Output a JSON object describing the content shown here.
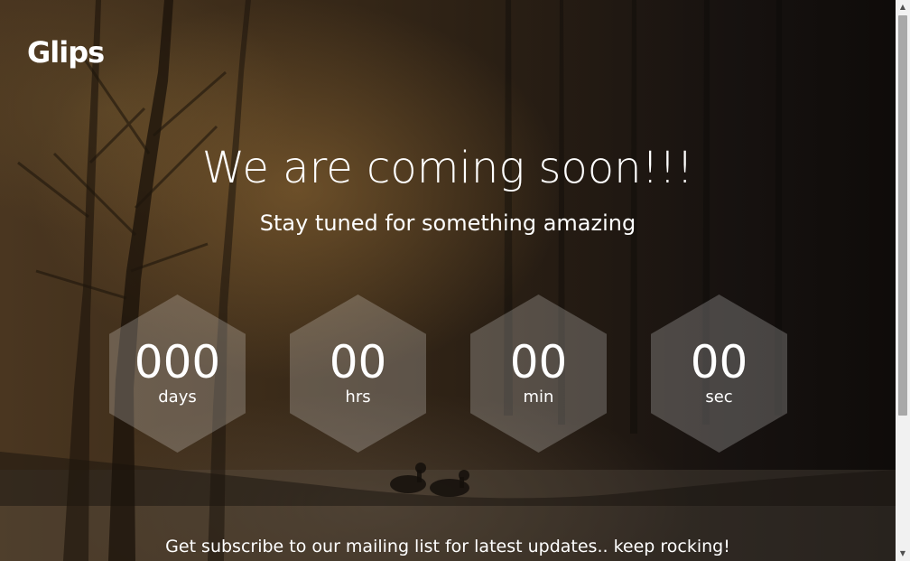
{
  "brand": {
    "logo_text": "Glips"
  },
  "hero": {
    "title": "We are coming soon!!!",
    "subtitle": "Stay tuned for something amazing"
  },
  "countdown": [
    {
      "value": "000",
      "unit": "days"
    },
    {
      "value": "00",
      "unit": "hrs"
    },
    {
      "value": "00",
      "unit": "min"
    },
    {
      "value": "00",
      "unit": "sec"
    }
  ],
  "footer": {
    "text": "Get subscribe to our mailing list for latest updates.. keep rocking!"
  },
  "colors": {
    "text": "#ffffff",
    "hexagon_fill": "rgba(255,255,255,0.22)",
    "background_warm": "#4a3620",
    "background_dark": "#0e0b09"
  },
  "icons": {
    "scroll_up": "triangle-up-icon",
    "scroll_down": "triangle-down-icon"
  }
}
